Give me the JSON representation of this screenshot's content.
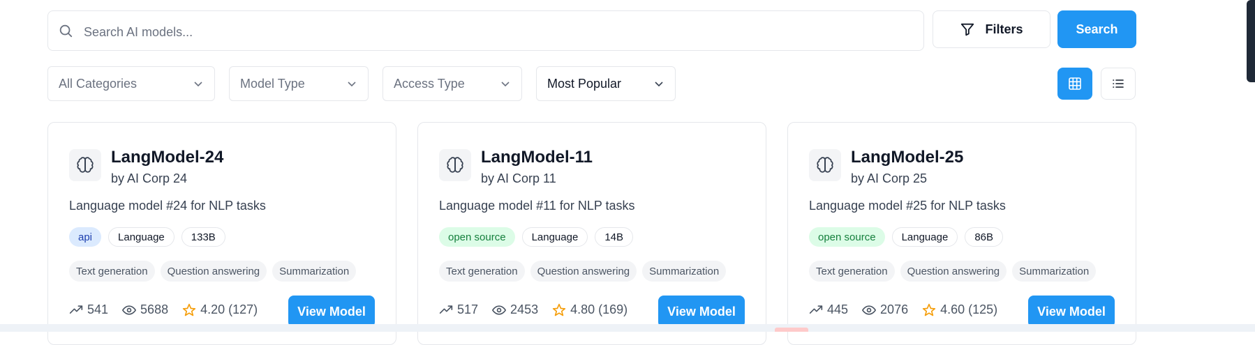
{
  "search": {
    "placeholder": "Search AI models..."
  },
  "toolbar": {
    "filters_label": "Filters",
    "search_label": "Search"
  },
  "filters": {
    "category": "All Categories",
    "model_type": "Model Type",
    "access_type": "Access Type",
    "sort": "Most Popular"
  },
  "view_mode": "grid",
  "colors": {
    "accent": "#2196f3",
    "api_badge": "#dbeafe",
    "open_source_badge": "#dcfce7",
    "star": "#f59e0b"
  },
  "models": [
    {
      "name": "LangModel-24",
      "provider": "by AI Corp 24",
      "description": "Language model #24 for NLP tasks",
      "access": "api",
      "category": "Language",
      "size": "133B",
      "capabilities": [
        "Text generation",
        "Question answering",
        "Summarization"
      ],
      "trend": "541",
      "views": "5688",
      "rating": "4.20 (127)",
      "cta": "View Model"
    },
    {
      "name": "LangModel-11",
      "provider": "by AI Corp 11",
      "description": "Language model #11 for NLP tasks",
      "access": "open source",
      "category": "Language",
      "size": "14B",
      "capabilities": [
        "Text generation",
        "Question answering",
        "Summarization"
      ],
      "trend": "517",
      "views": "2453",
      "rating": "4.80 (169)",
      "cta": "View Model"
    },
    {
      "name": "LangModel-25",
      "provider": "by AI Corp 25",
      "description": "Language model #25 for NLP tasks",
      "access": "open source",
      "category": "Language",
      "size": "86B",
      "capabilities": [
        "Text generation",
        "Question answering",
        "Summarization"
      ],
      "trend": "445",
      "views": "2076",
      "rating": "4.60 (125)",
      "cta": "View Model"
    }
  ]
}
